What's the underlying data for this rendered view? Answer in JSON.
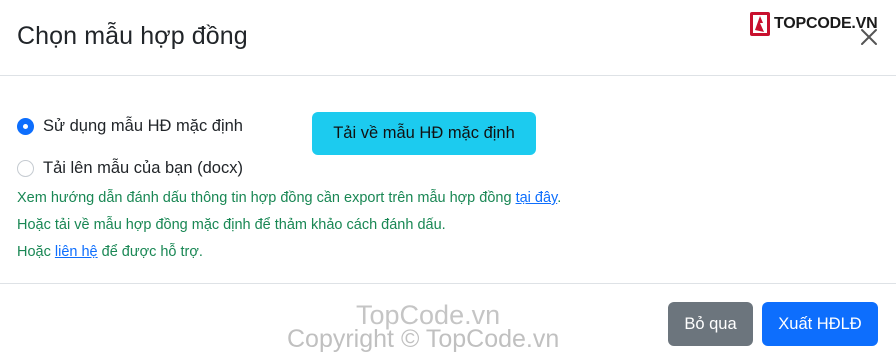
{
  "modal": {
    "title": "Chọn mẫu hợp đồng",
    "logo_text": "TOPCODE.VN"
  },
  "options": [
    {
      "label": "Sử dụng mẫu HĐ mặc định",
      "checked": true
    },
    {
      "label": "Tải lên mẫu của bạn (docx)",
      "checked": false
    }
  ],
  "download_button": {
    "label": "Tải về mẫu HĐ mặc định"
  },
  "help": {
    "line1_prefix": "Xem hướng dẫn đánh dấu thông tin hợp đồng cần export trên mẫu hợp đồng ",
    "line1_link": "tại đây",
    "line1_suffix": ".",
    "line2": "Hoặc tải về mẫu hợp đồng mặc định để thảm khảo cách đánh dấu.",
    "line3_prefix": "Hoặc ",
    "line3_link": "liên hệ",
    "line3_suffix": " để được hỗ trợ."
  },
  "footer": {
    "skip_label": "Bỏ qua",
    "export_label": "Xuất HĐLĐ"
  },
  "watermark": {
    "line1": "TopCode.vn",
    "line2": "Copyright © TopCode.vn"
  },
  "colors": {
    "primary": "#0d6efd",
    "info": "#1ccbef",
    "secondary": "#6c757d",
    "help_text": "#198754"
  }
}
